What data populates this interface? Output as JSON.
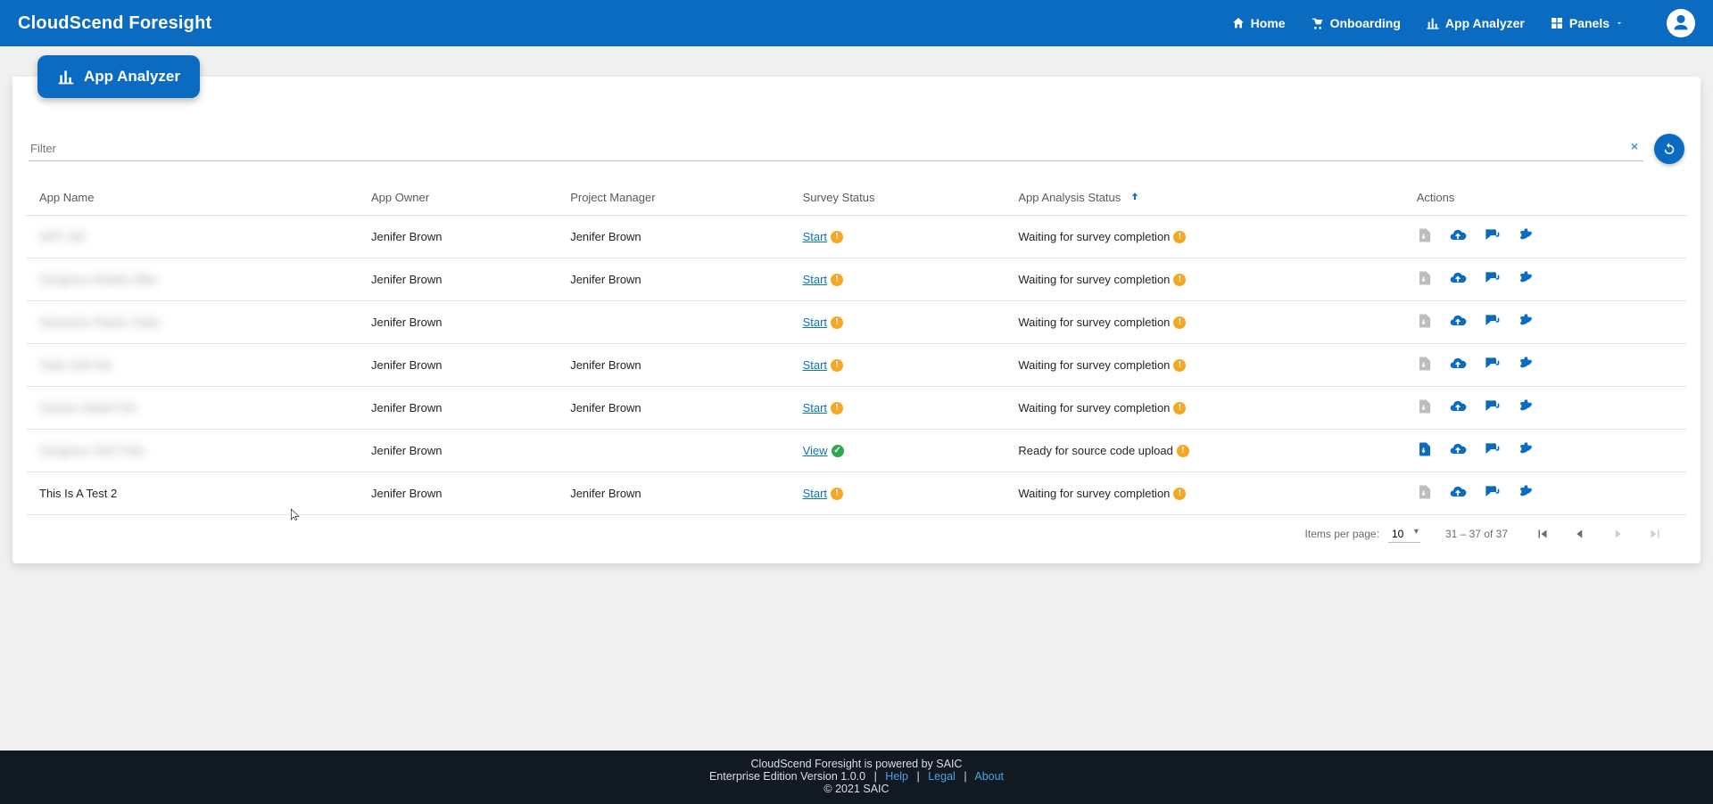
{
  "brand": "CloudScend Foresight",
  "nav": {
    "home": "Home",
    "onboarding": "Onboarding",
    "app_analyzer": "App Analyzer",
    "panels": "Panels"
  },
  "page": {
    "tab_label": "App Analyzer",
    "filter_placeholder": "Filter"
  },
  "columns": {
    "app_name": "App Name",
    "app_owner": "App Owner",
    "project_manager": "Project Manager",
    "survey_status": "Survey Status",
    "analysis_status": "App Analysis Status",
    "actions": "Actions"
  },
  "rows": [
    {
      "app_name": "APP-192",
      "blurred": true,
      "app_owner": "Jenifer Brown",
      "project_manager": "Jenifer Brown",
      "survey_link": "Start",
      "survey_state": "warn",
      "analysis": "Waiting for survey completion",
      "analysis_state": "warn",
      "download_enabled": false
    },
    {
      "app_name": "Gorgeous Rubber Bike",
      "blurred": true,
      "app_owner": "Jenifer Brown",
      "project_manager": "Jenifer Brown",
      "survey_link": "Start",
      "survey_state": "warn",
      "analysis": "Waiting for survey completion",
      "analysis_state": "warn",
      "download_enabled": false
    },
    {
      "app_name": "Awesome Plastic Chips",
      "blurred": true,
      "app_owner": "Jenifer Brown",
      "project_manager": "",
      "survey_link": "Start",
      "survey_state": "warn",
      "analysis": "Waiting for survey completion",
      "analysis_state": "warn",
      "download_enabled": false
    },
    {
      "app_name": "Tasty Soft Hat",
      "blurred": true,
      "app_owner": "Jenifer Brown",
      "project_manager": "Jenifer Brown",
      "survey_link": "Start",
      "survey_state": "warn",
      "analysis": "Waiting for survey completion",
      "analysis_state": "warn",
      "download_enabled": false
    },
    {
      "app_name": "Generic Metal Fish",
      "blurred": true,
      "app_owner": "Jenifer Brown",
      "project_manager": "Jenifer Brown",
      "survey_link": "Start",
      "survey_state": "warn",
      "analysis": "Waiting for survey completion",
      "analysis_state": "warn",
      "download_enabled": false
    },
    {
      "app_name": "Gorgeous Soft Chair",
      "blurred": true,
      "app_owner": "Jenifer Brown",
      "project_manager": "",
      "survey_link": "View",
      "survey_state": "ok",
      "analysis": "Ready for source code upload",
      "analysis_state": "warn",
      "download_enabled": true
    },
    {
      "app_name": "This Is A Test 2",
      "blurred": false,
      "app_owner": "Jenifer Brown",
      "project_manager": "Jenifer Brown",
      "survey_link": "Start",
      "survey_state": "warn",
      "analysis": "Waiting for survey completion",
      "analysis_state": "warn",
      "download_enabled": false
    }
  ],
  "paginator": {
    "items_per_page_label": "Items per page:",
    "items_per_page_value": "10",
    "range": "31 – 37 of 37"
  },
  "footer": {
    "line1": "CloudScend Foresight is powered by SAIC",
    "line2_prefix": "Enterprise Edition Version 1.0.0",
    "help": "Help",
    "legal": "Legal",
    "about": "About",
    "copyright": "© 2021 SAIC"
  }
}
